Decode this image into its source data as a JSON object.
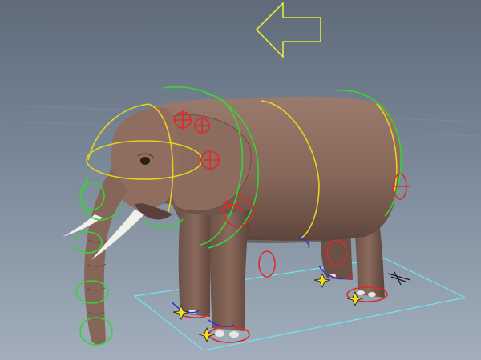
{
  "viewport": {
    "name": "3D viewport",
    "background_top": "#5f6b79",
    "background_bottom": "#a2aebb",
    "grid_color": "#8a96a3"
  },
  "rig": {
    "subject": "elephant",
    "colors": {
      "fk_controls": "#3ad13a",
      "spine_controls": "#e8d21a",
      "ik_controls": "#e02a2a",
      "pole_controls": "#2a3ad0",
      "ground_plane": "#6fe8f0",
      "direction_arrow": "#e8e83a",
      "pivot_markers": "#f0e020"
    },
    "skin_color": "#8a6a5c",
    "tusk_color": "#f2f0ea"
  }
}
